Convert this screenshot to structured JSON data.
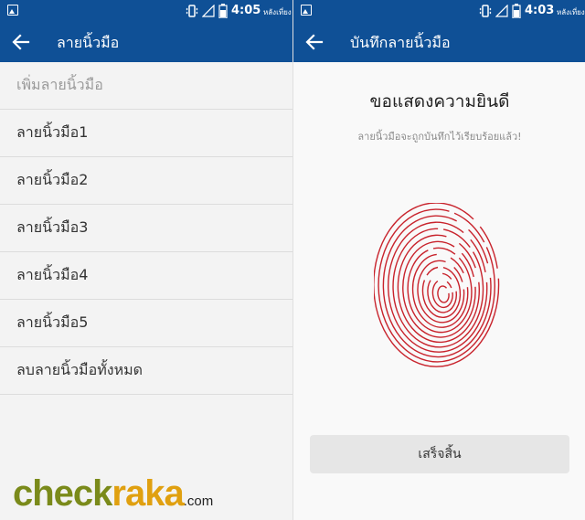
{
  "left_screen": {
    "status_bar": {
      "time": "4:05",
      "ampm": "หลังเที่ยง"
    },
    "app_bar": {
      "title": "ลายนิ้วมือ"
    },
    "list": [
      {
        "label": "เพิ่มลายนิ้วมือ",
        "enabled": false
      },
      {
        "label": "ลายนิ้วมือ1",
        "enabled": true
      },
      {
        "label": "ลายนิ้วมือ2",
        "enabled": true
      },
      {
        "label": "ลายนิ้วมือ3",
        "enabled": true
      },
      {
        "label": "ลายนิ้วมือ4",
        "enabled": true
      },
      {
        "label": "ลายนิ้วมือ5",
        "enabled": true
      },
      {
        "label": "ลบลายนิ้วมือทั้งหมด",
        "enabled": true
      }
    ]
  },
  "right_screen": {
    "status_bar": {
      "time": "4:03",
      "ampm": "หลังเที่ยง"
    },
    "app_bar": {
      "title": "บันทึกลายนิ้วมือ"
    },
    "heading": "ขอแสดงความยินดี",
    "subtitle": "ลายนิ้วมือจะถูกบันทึกไว้เรียบร้อยแล้ว!",
    "done_label": "เสร็จสิ้น",
    "fingerprint_color": "#c8232c"
  },
  "watermark": {
    "part_a": "check",
    "part_b": "raka",
    "tld": ".com"
  },
  "colors": {
    "primary": "#0f5096"
  },
  "icons": [
    "image-icon",
    "vibrate-icon",
    "signal-icon",
    "battery-icon",
    "back-arrow-icon",
    "fingerprint-icon"
  ]
}
